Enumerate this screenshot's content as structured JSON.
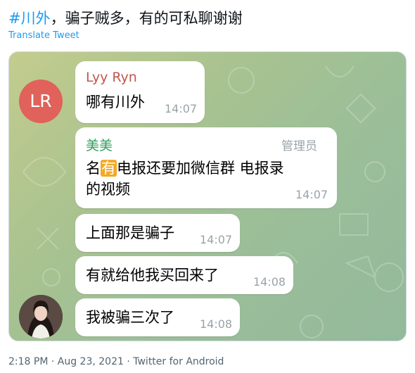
{
  "tweet": {
    "hashtag": "#川外",
    "text": "，骗子贼多，有的可私聊谢谢",
    "translate_label": "Translate Tweet",
    "meta": "2:18 PM · Aug 23, 2021 · Twitter for Android"
  },
  "chat": {
    "avatar_lr": {
      "initials": "LR",
      "color": "#e0625a"
    },
    "messages": [
      {
        "sender": "Lyy Ryn",
        "sender_color": "#c0574d",
        "text": "哪有川外",
        "time": "14:07"
      },
      {
        "sender": "美美",
        "sender_color": "#2f9e5a",
        "role": "管理员",
        "text_line1_pre": "名",
        "text_line1_highlight": "有",
        "text_line1_post": "电报还要加微信群 电报录",
        "text_line2": "的视频",
        "time": "14:07"
      },
      {
        "text": "上面那是骗子",
        "time": "14:07"
      },
      {
        "text": "有就给他我买回来了",
        "time": "14:08"
      },
      {
        "text": "我被骗三次了",
        "time": "14:08"
      }
    ]
  }
}
